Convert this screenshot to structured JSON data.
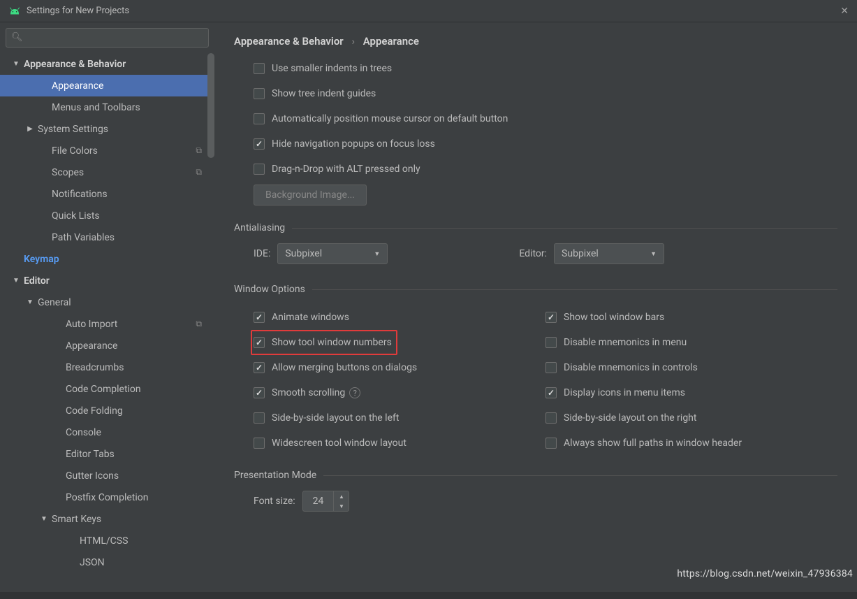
{
  "window": {
    "title": "Settings for New Projects"
  },
  "search": {
    "placeholder": ""
  },
  "sidebar": {
    "items": [
      {
        "label": "Appearance & Behavior",
        "bold": true,
        "arrow": "down",
        "indent": 0
      },
      {
        "label": "Appearance",
        "indent": 2,
        "selected": true
      },
      {
        "label": "Menus and Toolbars",
        "indent": 2
      },
      {
        "label": "System Settings",
        "arrow": "right",
        "indent": 1
      },
      {
        "label": "File Colors",
        "indent": 2,
        "tag": "⧉"
      },
      {
        "label": "Scopes",
        "indent": 2,
        "tag": "⧉"
      },
      {
        "label": "Notifications",
        "indent": 2
      },
      {
        "label": "Quick Lists",
        "indent": 2
      },
      {
        "label": "Path Variables",
        "indent": 2
      },
      {
        "label": "Keymap",
        "bold": true,
        "link": true,
        "indent": 0
      },
      {
        "label": "Editor",
        "bold": true,
        "arrow": "down",
        "indent": 0
      },
      {
        "label": "General",
        "arrow": "down",
        "indent": 1
      },
      {
        "label": "Auto Import",
        "indent": 3,
        "tag": "⧉"
      },
      {
        "label": "Appearance",
        "indent": 3
      },
      {
        "label": "Breadcrumbs",
        "indent": 3
      },
      {
        "label": "Code Completion",
        "indent": 3
      },
      {
        "label": "Code Folding",
        "indent": 3
      },
      {
        "label": "Console",
        "indent": 3
      },
      {
        "label": "Editor Tabs",
        "indent": 3
      },
      {
        "label": "Gutter Icons",
        "indent": 3
      },
      {
        "label": "Postfix Completion",
        "indent": 3
      },
      {
        "label": "Smart Keys",
        "arrow": "down",
        "indent": 2
      },
      {
        "label": "HTML/CSS",
        "indent": 4
      },
      {
        "label": "JSON",
        "indent": 4
      }
    ]
  },
  "breadcrumb": {
    "a": "Appearance & Behavior",
    "b": "Appearance"
  },
  "topChecks": [
    {
      "label": "Use smaller indents in trees",
      "checked": false
    },
    {
      "label": "Show tree indent guides",
      "checked": false
    },
    {
      "label": "Automatically position mouse cursor on default button",
      "checked": false
    },
    {
      "label": "Hide navigation popups on focus loss",
      "checked": true
    },
    {
      "label": "Drag-n-Drop with ALT pressed only",
      "checked": false
    }
  ],
  "bgButton": "Background Image...",
  "sections": {
    "antialiasing": {
      "title": "Antialiasing",
      "ide_label": "IDE:",
      "ide_value": "Subpixel",
      "editor_label": "Editor:",
      "editor_value": "Subpixel"
    },
    "window": {
      "title": "Window Options"
    },
    "presentation": {
      "title": "Presentation Mode",
      "font_label": "Font size:",
      "font_value": "24"
    }
  },
  "windowLeft": [
    {
      "label": "Animate windows",
      "checked": true
    },
    {
      "label": "Show tool window numbers",
      "checked": true,
      "highlight": true
    },
    {
      "label": "Allow merging buttons on dialogs",
      "checked": true
    },
    {
      "label": "Smooth scrolling",
      "checked": true,
      "help": true
    },
    {
      "label": "Side-by-side layout on the left",
      "checked": false
    },
    {
      "label": "Widescreen tool window layout",
      "checked": false
    }
  ],
  "windowRight": [
    {
      "label": "Show tool window bars",
      "checked": true
    },
    {
      "label": "Disable mnemonics in menu",
      "checked": false
    },
    {
      "label": "Disable mnemonics in controls",
      "checked": false
    },
    {
      "label": "Display icons in menu items",
      "checked": true
    },
    {
      "label": "Side-by-side layout on the right",
      "checked": false
    },
    {
      "label": "Always show full paths in window header",
      "checked": false
    }
  ],
  "watermark": "https://blog.csdn.net/weixin_47936384"
}
